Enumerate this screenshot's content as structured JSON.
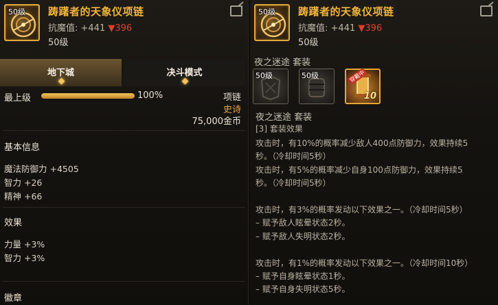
{
  "left": {
    "item": {
      "level_badge": "50级",
      "title": "踌躇者的天象仪项链",
      "resist_label": "抗魔值:",
      "resist_base": "+441",
      "resist_compare": "▼396",
      "level": "50级"
    },
    "tabs": [
      {
        "label": "地下城"
      },
      {
        "label": "决斗模式"
      }
    ],
    "max_level_label": "最上级",
    "progress_percent": 100,
    "progress_text": "100%",
    "item_type": "项链",
    "rarity": "史诗",
    "price": "75,000金币",
    "sections": {
      "basic": {
        "title": "基本信息",
        "stats": [
          "魔法防御力 +4505",
          "智力 +26",
          "精神 +66"
        ]
      },
      "effect": {
        "title": "效果",
        "stats": [
          "力量 +3%",
          "智力 +3%"
        ]
      },
      "emblem": {
        "title": "徽章"
      }
    }
  },
  "right": {
    "item": {
      "level_badge": "50级",
      "title": "踌躇者的天象仪项链",
      "resist_label": "抗魔值:",
      "resist_base": "+441",
      "resist_compare": "▼396",
      "level": "50级"
    },
    "set_header": "夜之迷途  套装",
    "set_items": [
      {
        "level_badge": "50级",
        "icon": "dark-armor-icon"
      },
      {
        "level_badge": "50级",
        "icon": "dark-gauntlet-icon"
      },
      {
        "ribbon": "穿戴中",
        "number": "10",
        "icon": "gold-scroll-icon"
      }
    ],
    "set_name": "夜之迷途  套装",
    "set_effect_title": "[3] 套装效果",
    "effects": [
      "攻击时，有10%的概率减少敌人400点防御力，效果持续5",
      "秒。（冷却时间5秒）",
      "攻击时，有5%的概率减少自身100点防御力，效果持续5",
      "秒。（冷却时间5秒）",
      "",
      "攻击时，有3%的概率发动以下效果之一。（冷却时间5秒）",
      "– 赋予敌人眩晕状态2秒。",
      "– 赋予敌人失明状态2秒。",
      "",
      "攻击时，有1%的概率发动以下效果之一。（冷却时间10秒）",
      "– 赋予自身眩晕状态1秒。",
      "– 赋予自身失明状态5秒。"
    ]
  },
  "colors": {
    "title": "#f0b53c",
    "rarity_epic": "#f0a23c",
    "decrease": "#e0402c",
    "frame_gold": "#e4a93a"
  }
}
